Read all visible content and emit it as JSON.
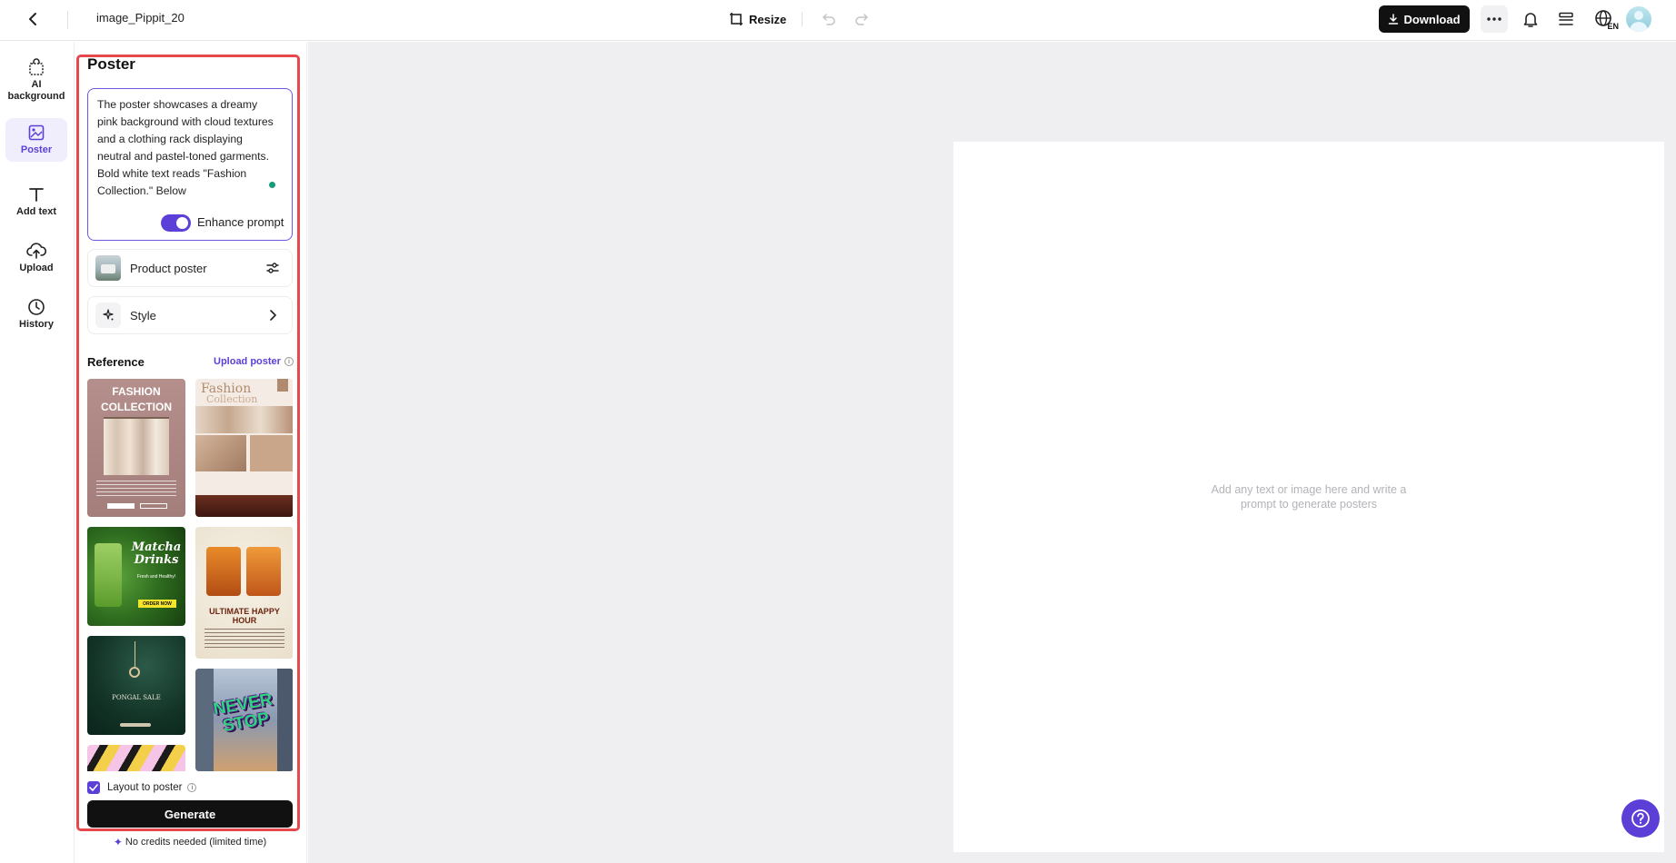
{
  "topbar": {
    "title": "image_Pippit_20",
    "resize_label": "Resize",
    "download_label": "Download",
    "lang_badge": "EN"
  },
  "rail": {
    "items": [
      {
        "label": "AI background"
      },
      {
        "label": "Poster"
      },
      {
        "label": "Add text"
      },
      {
        "label": "Upload"
      },
      {
        "label": "History"
      }
    ]
  },
  "panel": {
    "title": "Poster",
    "prompt": "The poster showcases a dreamy pink background with cloud textures and a clothing rack displaying neutral and pastel-toned garments. Bold white text reads \"Fashion Collection.\" Below",
    "enhance_label": "Enhance prompt",
    "enhance_enabled": true,
    "product_label": "Product poster",
    "style_label": "Style",
    "reference_title": "Reference",
    "upload_label": "Upload poster",
    "layout_label": "Layout to poster",
    "layout_checked": true,
    "generate_label": "Generate",
    "credits_label": "No credits needed (limited time)"
  },
  "gallery": {
    "fashion_title": "FASHION COLLECTION",
    "fashion2_title": "Fashion",
    "fashion2_sub": "Collection",
    "matcha_title": "Matcha Drinks",
    "matcha_sub": "Fresh and Healthy!",
    "matcha_cta": "ORDER NOW",
    "hour_title": "ULTIMATE HAPPY HOUR",
    "pongal_title": "PONGAL SALE",
    "never_title": "NEVER STOP"
  },
  "canvas": {
    "hint_line1": "Add any text or image here and write a",
    "hint_line2": "prompt to generate posters"
  },
  "colors": {
    "accent": "#5b3fd6",
    "highlight": "#e5484d",
    "workspace_bg": "#efeff1"
  }
}
